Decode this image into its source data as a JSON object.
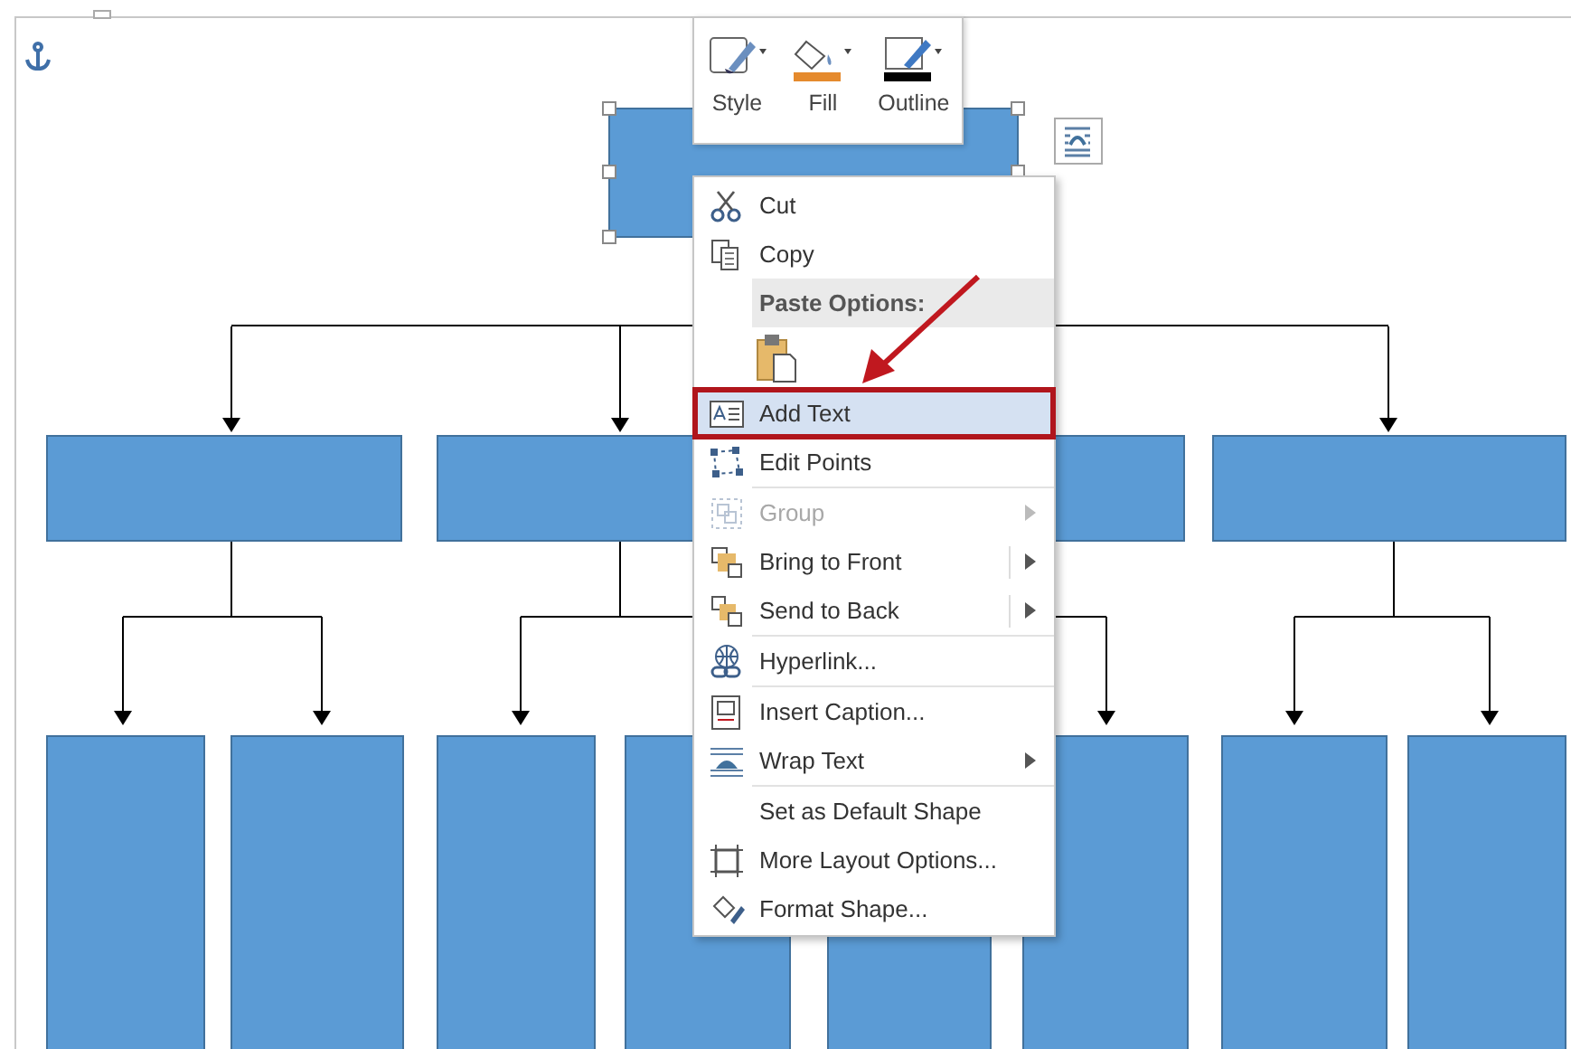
{
  "diagram": {
    "top_shape": {
      "selected": true
    }
  },
  "mini_toolbar": [
    {
      "label": "Style",
      "kind": "style"
    },
    {
      "label": "Fill",
      "kind": "fill"
    },
    {
      "label": "Outline",
      "kind": "outline"
    }
  ],
  "context_menu": [
    {
      "kind": "item",
      "label": "Cut",
      "disabled": false,
      "submenu": false,
      "highlighted": false
    },
    {
      "kind": "item",
      "label": "Copy",
      "disabled": false,
      "submenu": false,
      "highlighted": false
    },
    {
      "kind": "header",
      "label": "Paste Options:"
    },
    {
      "kind": "paste"
    },
    {
      "kind": "item",
      "label": "Add Text",
      "disabled": false,
      "submenu": false,
      "highlighted": true
    },
    {
      "kind": "item",
      "label": "Edit Points",
      "disabled": false,
      "submenu": false,
      "highlighted": false
    },
    {
      "kind": "separator"
    },
    {
      "kind": "item",
      "label": "Group",
      "disabled": true,
      "submenu": true,
      "highlighted": false
    },
    {
      "kind": "item",
      "label": "Bring to Front",
      "disabled": false,
      "submenu": true,
      "split": true,
      "highlighted": false
    },
    {
      "kind": "item",
      "label": "Send to Back",
      "disabled": false,
      "submenu": true,
      "split": true,
      "highlighted": false
    },
    {
      "kind": "separator"
    },
    {
      "kind": "item",
      "label": "Hyperlink...",
      "disabled": false,
      "submenu": false,
      "highlighted": false
    },
    {
      "kind": "separator"
    },
    {
      "kind": "item",
      "label": "Insert Caption...",
      "disabled": false,
      "submenu": false,
      "highlighted": false
    },
    {
      "kind": "item",
      "label": "Wrap Text",
      "disabled": false,
      "submenu": true,
      "highlighted": false
    },
    {
      "kind": "separator"
    },
    {
      "kind": "item",
      "label": "Set as Default Shape",
      "disabled": false,
      "submenu": false,
      "highlighted": false
    },
    {
      "kind": "item",
      "label": "More Layout Options...",
      "disabled": false,
      "submenu": false,
      "highlighted": false
    },
    {
      "kind": "item",
      "label": "Format Shape...",
      "disabled": false,
      "submenu": false,
      "highlighted": false
    }
  ]
}
